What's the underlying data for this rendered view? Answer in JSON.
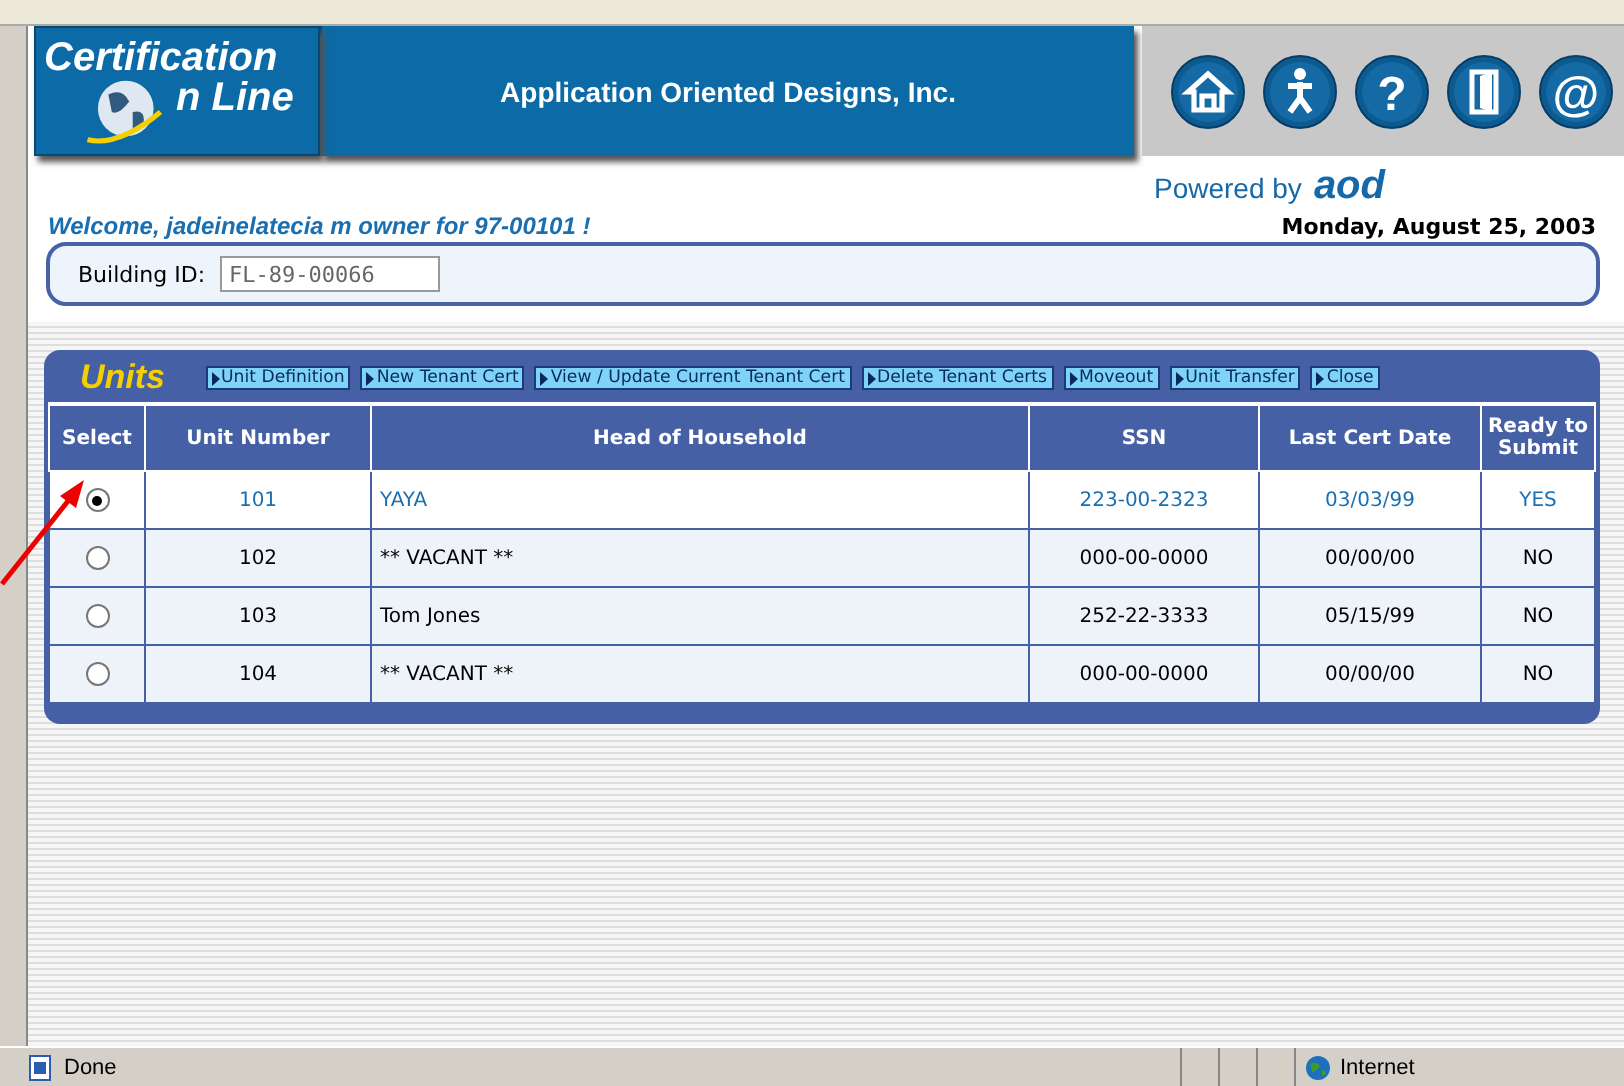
{
  "header": {
    "logo_line1": "Certification",
    "logo_line2": "n Line",
    "company": "Application Oriented Designs, Inc.",
    "nav_icons": [
      {
        "kind": "home"
      },
      {
        "kind": "person"
      },
      {
        "kind": "help",
        "glyph": "?"
      },
      {
        "kind": "door"
      },
      {
        "kind": "email",
        "glyph": "@"
      }
    ],
    "powered_by": "Powered by",
    "powered_brand": "aod"
  },
  "welcome": "Welcome, jadeinelatecia m owner for 97-00101 !",
  "date": "Monday, August 25, 2003",
  "building": {
    "label": "Building ID:",
    "value": "FL-89-00066"
  },
  "units": {
    "title": "Units",
    "actions": [
      "Unit Definition",
      "New Tenant Cert",
      "View / Update Current Tenant Cert",
      "Delete Tenant Certs",
      "Moveout",
      "Unit Transfer",
      "Close"
    ],
    "columns": [
      "Select",
      "Unit Number",
      "Head of Household",
      "SSN",
      "Last Cert Date",
      "Ready to Submit"
    ],
    "rows": [
      {
        "selected": true,
        "unit": "101",
        "head": "YAYA",
        "ssn": "223-00-2323",
        "last_cert": "03/03/99",
        "ready": "YES"
      },
      {
        "selected": false,
        "unit": "102",
        "head": "** VACANT **",
        "ssn": "000-00-0000",
        "last_cert": "00/00/00",
        "ready": "NO"
      },
      {
        "selected": false,
        "unit": "103",
        "head": "Tom Jones",
        "ssn": "252-22-3333",
        "last_cert": "05/15/99",
        "ready": "NO"
      },
      {
        "selected": false,
        "unit": "104",
        "head": "** VACANT **",
        "ssn": "000-00-0000",
        "last_cert": "00/00/00",
        "ready": "NO"
      }
    ]
  },
  "status_bar": {
    "status": "Done",
    "zone": "Internet"
  }
}
